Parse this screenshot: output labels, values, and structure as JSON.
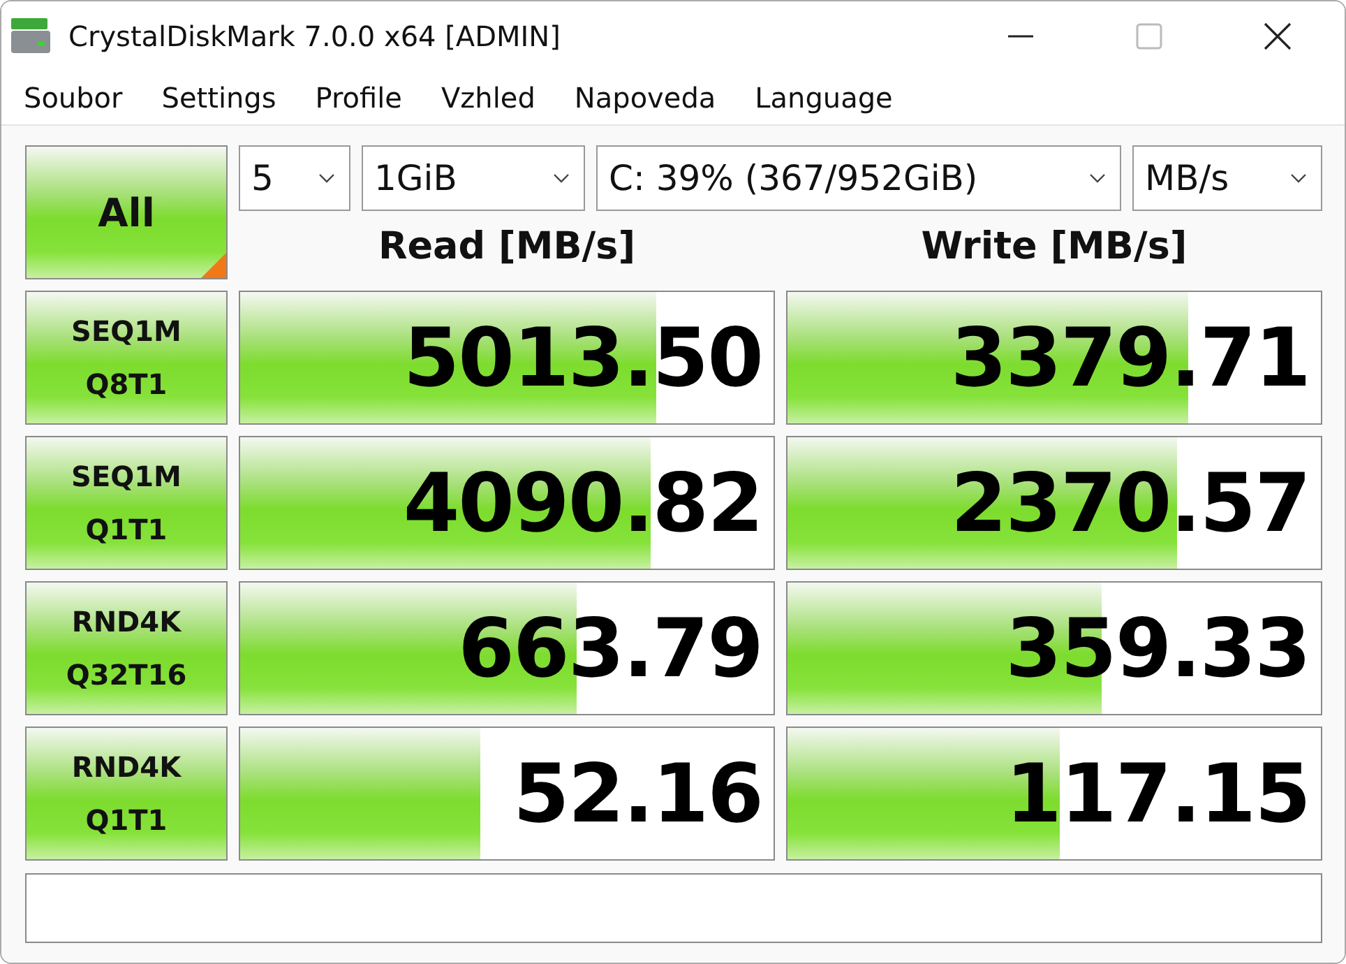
{
  "window": {
    "title": "CrystalDiskMark 7.0.0 x64 [ADMIN]"
  },
  "menu": [
    "Soubor",
    "Settings",
    "Profile",
    "Vzhled",
    "Napoveda",
    "Language"
  ],
  "all_button": {
    "label": "All"
  },
  "selectors": [
    {
      "value": "5"
    },
    {
      "value": "1GiB"
    },
    {
      "value": "C: 39% (367/952GiB)"
    },
    {
      "value": "MB/s"
    }
  ],
  "headers": {
    "read": "Read [MB/s]",
    "write": "Write [MB/s]"
  },
  "tests": [
    {
      "name": "SEQ1M",
      "params": "Q8T1",
      "read": {
        "value": "5013.50",
        "level": 0.78
      },
      "write": {
        "value": "3379.71",
        "level": 0.75
      }
    },
    {
      "name": "SEQ1M",
      "params": "Q1T1",
      "read": {
        "value": "4090.82",
        "level": 0.77
      },
      "write": {
        "value": "2370.57",
        "level": 0.73
      }
    },
    {
      "name": "RND4K",
      "params": "Q32T16",
      "read": {
        "value": "663.79",
        "level": 0.63
      },
      "write": {
        "value": "359.33",
        "level": 0.59
      }
    },
    {
      "name": "RND4K",
      "params": "Q1T1",
      "read": {
        "value": "52.16",
        "level": 0.45
      },
      "write": {
        "value": "117.15",
        "level": 0.51
      }
    }
  ]
}
